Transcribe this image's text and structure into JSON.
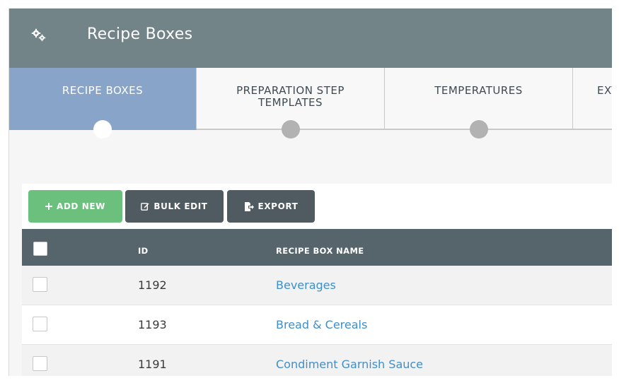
{
  "header": {
    "title": "Recipe Boxes",
    "icon": "gears-icon"
  },
  "tabs": [
    {
      "label": "RECIPE BOXES",
      "active": true
    },
    {
      "label": "PREPARATION STEP TEMPLATES",
      "active": false
    },
    {
      "label": "TEMPERATURES",
      "active": false
    },
    {
      "label": "EXT",
      "active": false
    }
  ],
  "toolbar": {
    "add_label": "ADD NEW",
    "bulk_label": "BULK EDIT",
    "export_label": "EXPORT"
  },
  "table": {
    "columns": {
      "id": "ID",
      "name": "RECIPE BOX NAME"
    },
    "rows": [
      {
        "id": "1192",
        "name": "Beverages"
      },
      {
        "id": "1193",
        "name": "Bread & Cereals"
      },
      {
        "id": "1191",
        "name": "Condiment Garnish Sauce"
      }
    ]
  },
  "colors": {
    "header_bg": "#738489",
    "active_tab": "#88a5c9",
    "add_button": "#6cc07e",
    "dark_button": "#4f5a61",
    "link": "#3f8fc8"
  }
}
